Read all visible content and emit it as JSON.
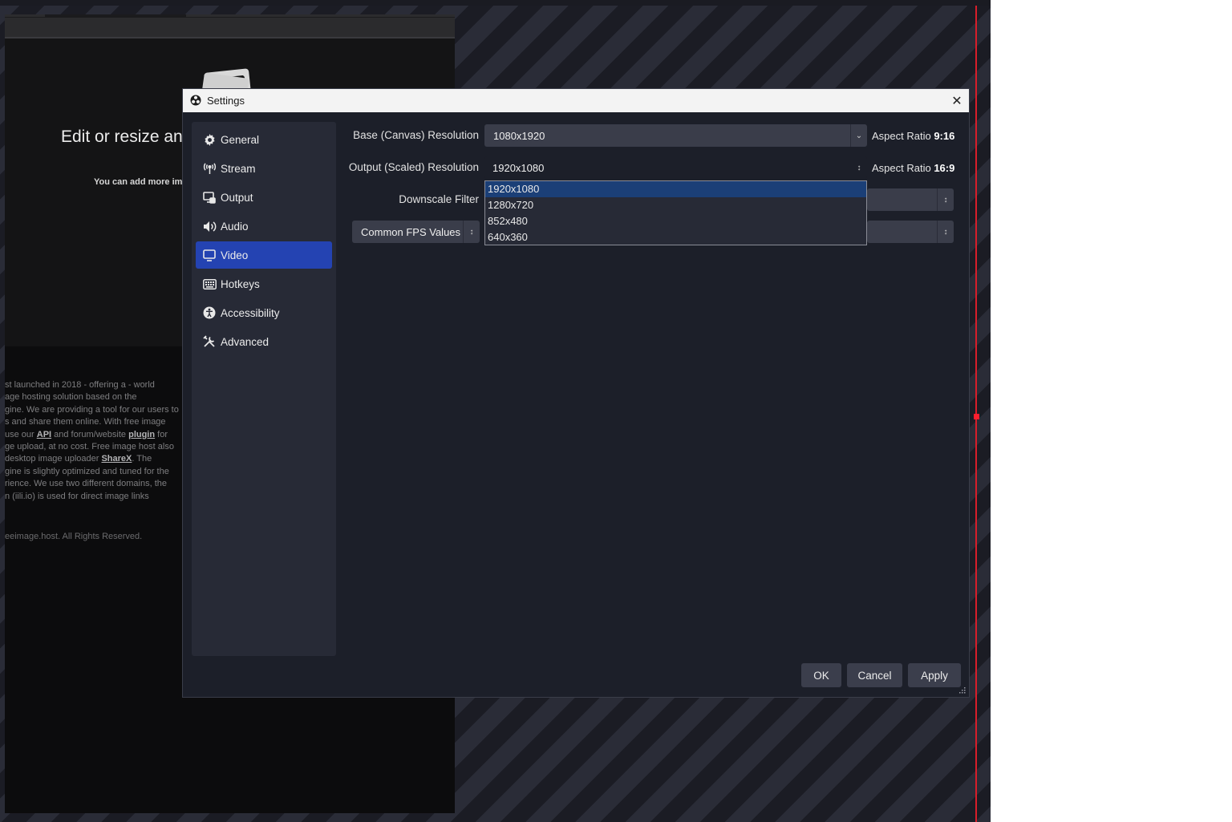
{
  "background_page": {
    "hero_title": "Edit or resize any",
    "hero_subtitle": "You can add more im",
    "about_lines": [
      {
        "parts": [
          "st launched in 2018 - offering a - world"
        ]
      },
      {
        "parts": [
          "age hosting solution based on the"
        ]
      },
      {
        "parts": [
          "gine. We are providing a tool for our users to"
        ]
      },
      {
        "parts": [
          "s and share them online. With free image"
        ]
      },
      {
        "parts": [
          "use our ",
          "API",
          " and forum/website ",
          "plugin",
          " for"
        ]
      },
      {
        "parts": [
          "ge upload, at no cost. Free image host also"
        ]
      },
      {
        "parts": [
          " desktop image uploader ",
          "ShareX",
          ". The"
        ]
      },
      {
        "parts": [
          "gine is slightly optimized and tuned for the"
        ]
      },
      {
        "parts": [
          "rience. We use two different domains, the"
        ]
      },
      {
        "parts": [
          "n (iili.io) is used for direct image links"
        ]
      }
    ],
    "copyright": "eeimage.host. All Rights Reserved."
  },
  "dialog": {
    "title": "Settings",
    "close_symbol": "✕",
    "sidebar": {
      "items": [
        {
          "id": "general",
          "label": "General",
          "icon": "gear-icon"
        },
        {
          "id": "stream",
          "label": "Stream",
          "icon": "antenna-icon"
        },
        {
          "id": "output",
          "label": "Output",
          "icon": "output-icon"
        },
        {
          "id": "audio",
          "label": "Audio",
          "icon": "speaker-icon"
        },
        {
          "id": "video",
          "label": "Video",
          "icon": "monitor-icon",
          "active": true
        },
        {
          "id": "hotkeys",
          "label": "Hotkeys",
          "icon": "keyboard-icon"
        },
        {
          "id": "accessibility",
          "label": "Accessibility",
          "icon": "accessibility-icon"
        },
        {
          "id": "advanced",
          "label": "Advanced",
          "icon": "tools-icon"
        }
      ]
    },
    "video": {
      "base_label": "Base (Canvas) Resolution",
      "base_value": "1080x1920",
      "base_aspect_prefix": "Aspect Ratio ",
      "base_aspect_value": "9:16",
      "output_label": "Output (Scaled) Resolution",
      "output_value": "1920x1080",
      "output_aspect_prefix": "Aspect Ratio ",
      "output_aspect_value": "16:9",
      "downscale_label": "Downscale Filter",
      "fps_type_value": "Common FPS Values",
      "output_options": [
        "1920x1080",
        "1280x720",
        "852x480",
        "640x360"
      ],
      "output_selected_index": 0
    },
    "buttons": {
      "ok": "OK",
      "cancel": "Cancel",
      "apply": "Apply"
    }
  },
  "colors": {
    "accent": "#2443b2",
    "dialog_bg": "#1c1f29",
    "panel_bg": "#272a36",
    "control_bg": "#3a3d4a",
    "selection": "#1b3f77",
    "preview_border": "#d81e2a"
  }
}
